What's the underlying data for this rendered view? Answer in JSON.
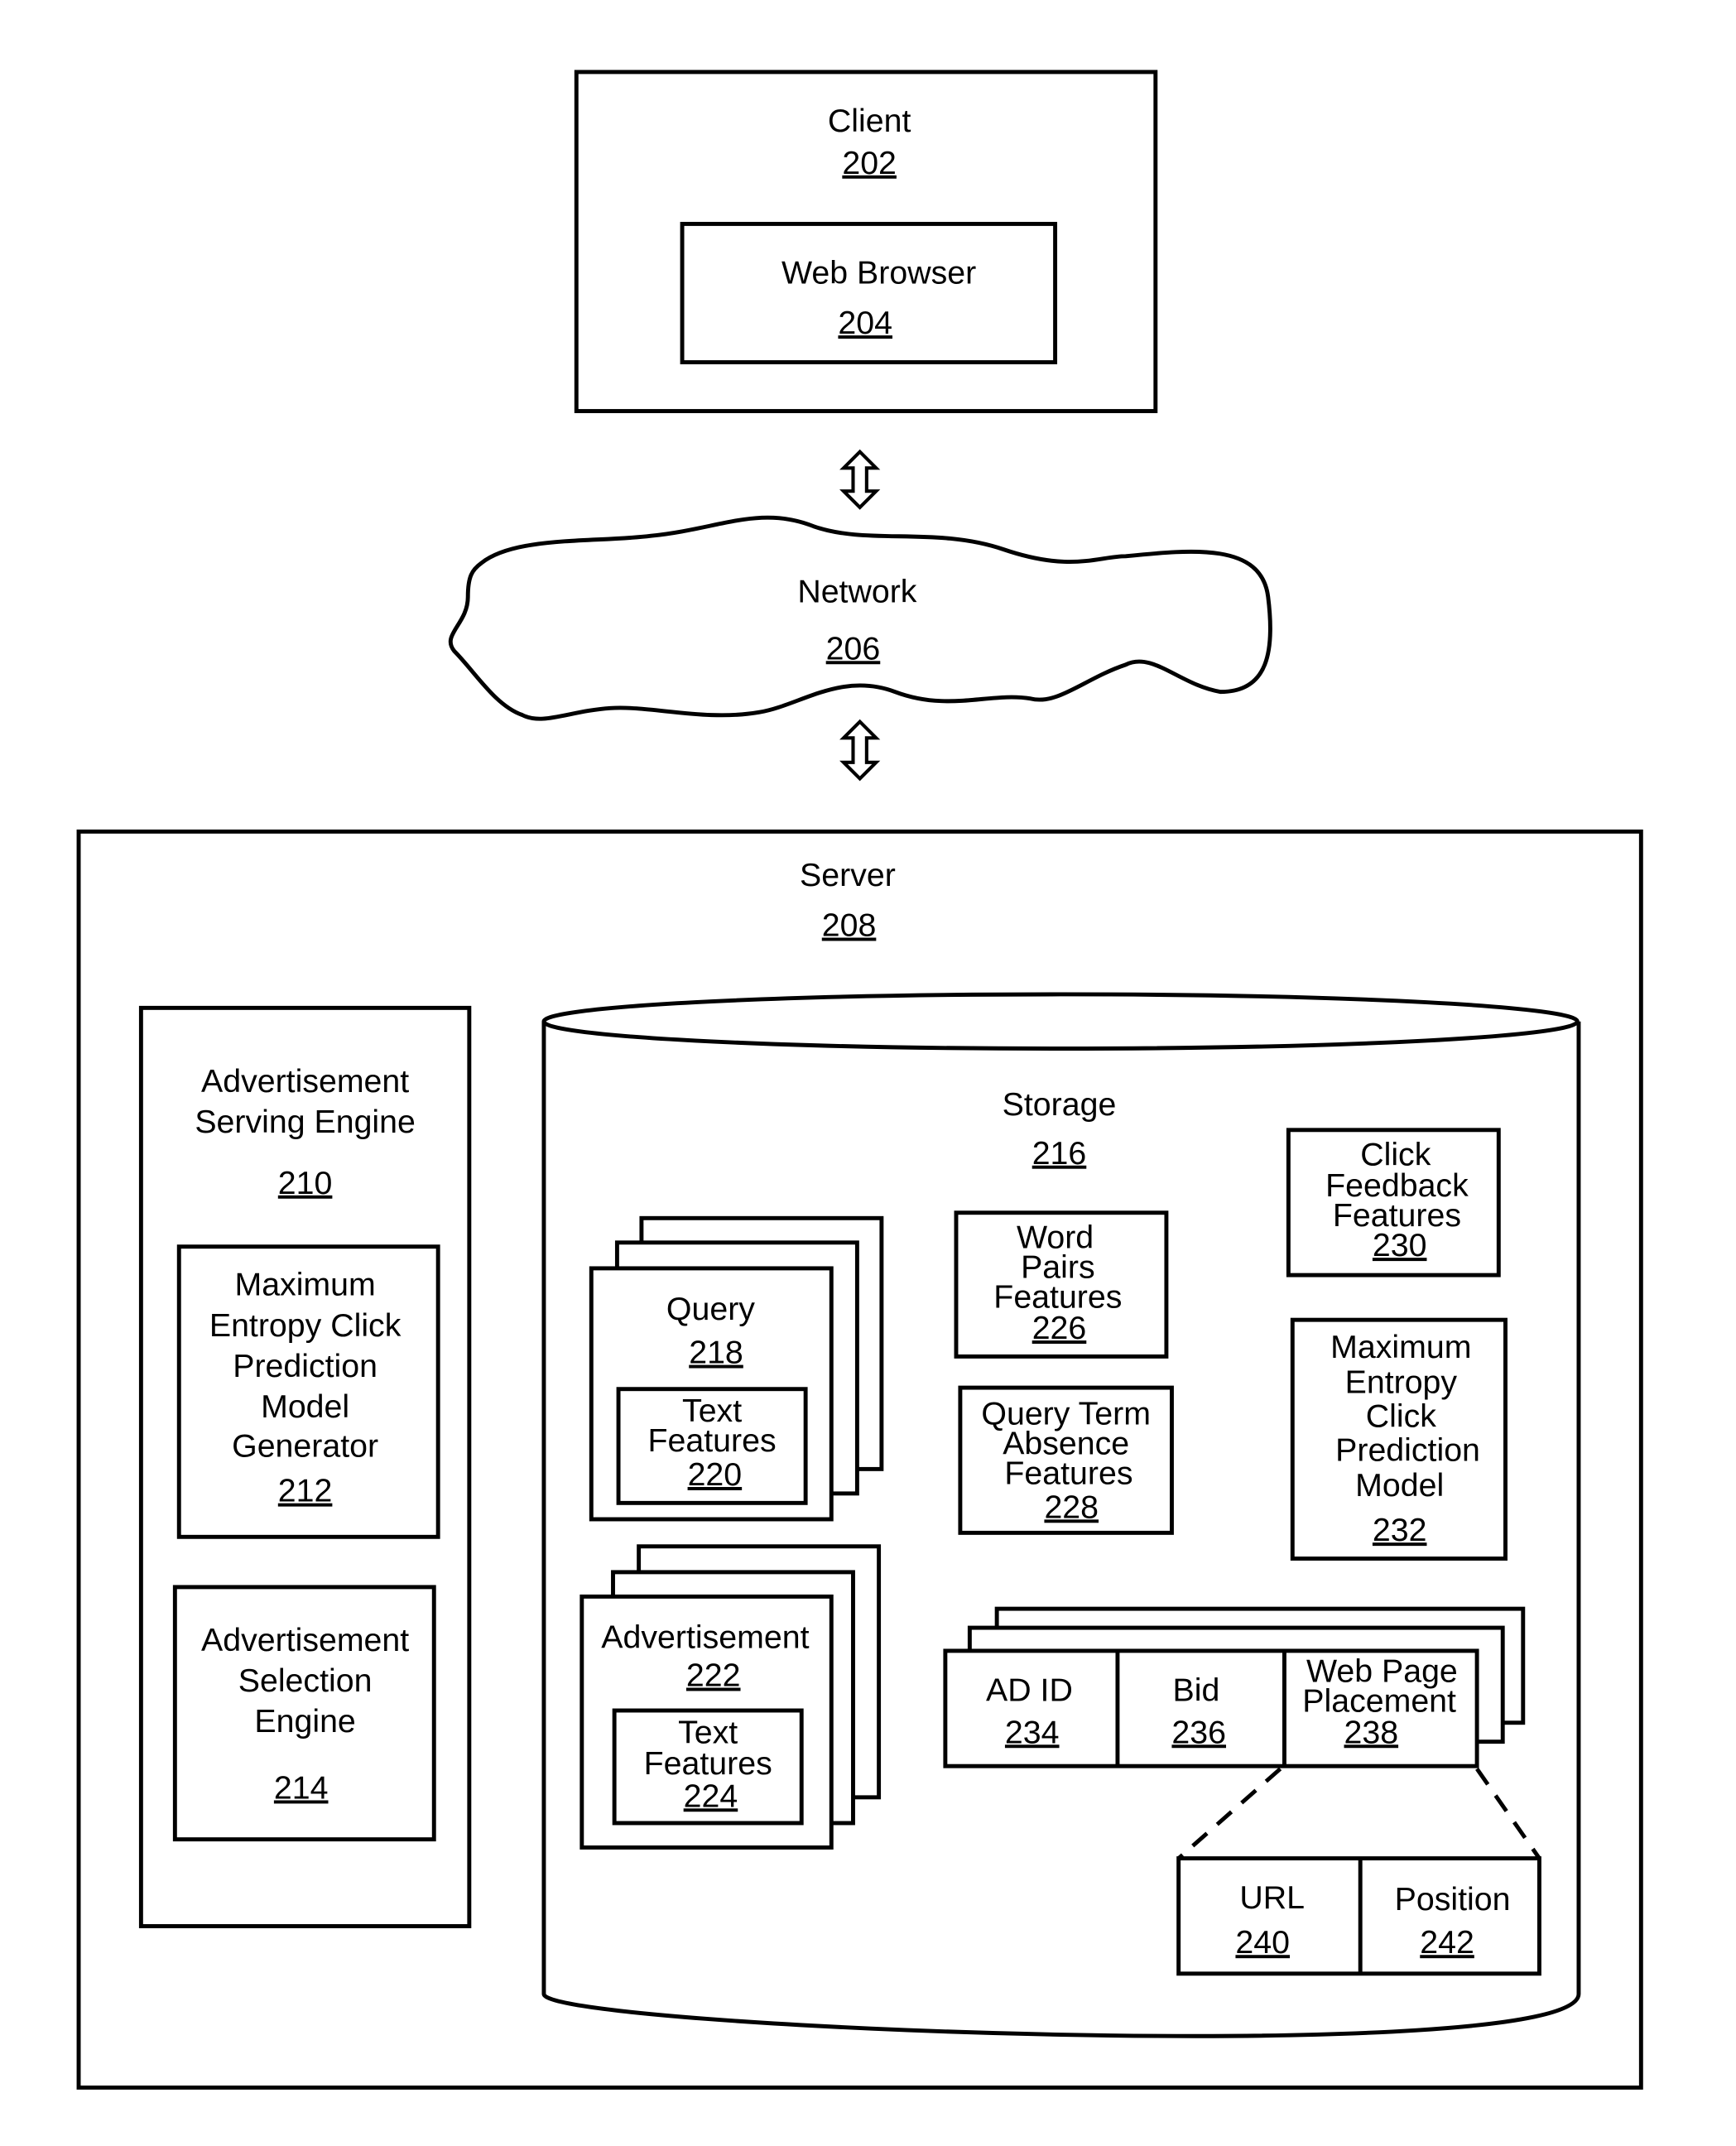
{
  "client": {
    "label": "Client",
    "ref": "202"
  },
  "web_browser": {
    "label": "Web Browser",
    "ref": "204"
  },
  "network": {
    "label": "Network",
    "ref": "206"
  },
  "server": {
    "label": "Server",
    "ref": "208"
  },
  "ad_serving_engine": {
    "lines": [
      "Advertisement",
      "Serving Engine"
    ],
    "ref": "210"
  },
  "me_model_generator": {
    "lines": [
      "Maximum",
      "Entropy Click",
      "Prediction",
      "Model",
      "Generator"
    ],
    "ref": "212"
  },
  "ad_selection_engine": {
    "lines": [
      "Advertisement",
      "Selection",
      "Engine"
    ],
    "ref": "214"
  },
  "storage": {
    "label": "Storage",
    "ref": "216"
  },
  "query": {
    "label": "Query",
    "ref": "218"
  },
  "query_text_features": {
    "lines": [
      "Text",
      "Features"
    ],
    "ref": "220"
  },
  "advertisement": {
    "label": "Advertisement",
    "ref": "222"
  },
  "ad_text_features": {
    "lines": [
      "Text",
      "Features"
    ],
    "ref": "224"
  },
  "word_pairs": {
    "lines": [
      "Word",
      "Pairs",
      "Features"
    ],
    "ref": "226"
  },
  "query_term_absence": {
    "lines": [
      "Query Term",
      "Absence",
      "Features"
    ],
    "ref": "228"
  },
  "click_feedback": {
    "lines": [
      "Click",
      "Feedback",
      "Features"
    ],
    "ref": "230"
  },
  "me_model": {
    "lines": [
      "Maximum",
      "Entropy",
      "Click",
      "Prediction",
      "Model"
    ],
    "ref": "232"
  },
  "ad_id": {
    "label": "AD ID",
    "ref": "234"
  },
  "bid": {
    "label": "Bid",
    "ref": "236"
  },
  "web_page_placement": {
    "lines": [
      "Web Page",
      "Placement"
    ],
    "ref": "238"
  },
  "url": {
    "label": "URL",
    "ref": "240"
  },
  "position": {
    "label": "Position",
    "ref": "242"
  }
}
